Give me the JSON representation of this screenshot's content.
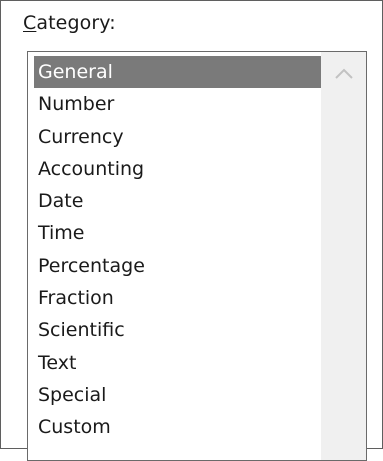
{
  "category_group": {
    "label_mnemonic": "C",
    "label_rest": "ategory:"
  },
  "category_list": {
    "items": [
      {
        "label": "General",
        "selected": true
      },
      {
        "label": "Number",
        "selected": false
      },
      {
        "label": "Currency",
        "selected": false
      },
      {
        "label": "Accounting",
        "selected": false
      },
      {
        "label": "Date",
        "selected": false
      },
      {
        "label": "Time",
        "selected": false
      },
      {
        "label": "Percentage",
        "selected": false
      },
      {
        "label": "Fraction",
        "selected": false
      },
      {
        "label": "Scientific",
        "selected": false
      },
      {
        "label": "Text",
        "selected": false
      },
      {
        "label": "Special",
        "selected": false
      },
      {
        "label": "Custom",
        "selected": false
      }
    ]
  },
  "scrollbar": {
    "up_icon": "chevron-up-icon"
  },
  "colors": {
    "selection_bg": "#7a7a7a",
    "scrollbar_bg": "#f0f0f0",
    "border": "#6a6a6a"
  }
}
